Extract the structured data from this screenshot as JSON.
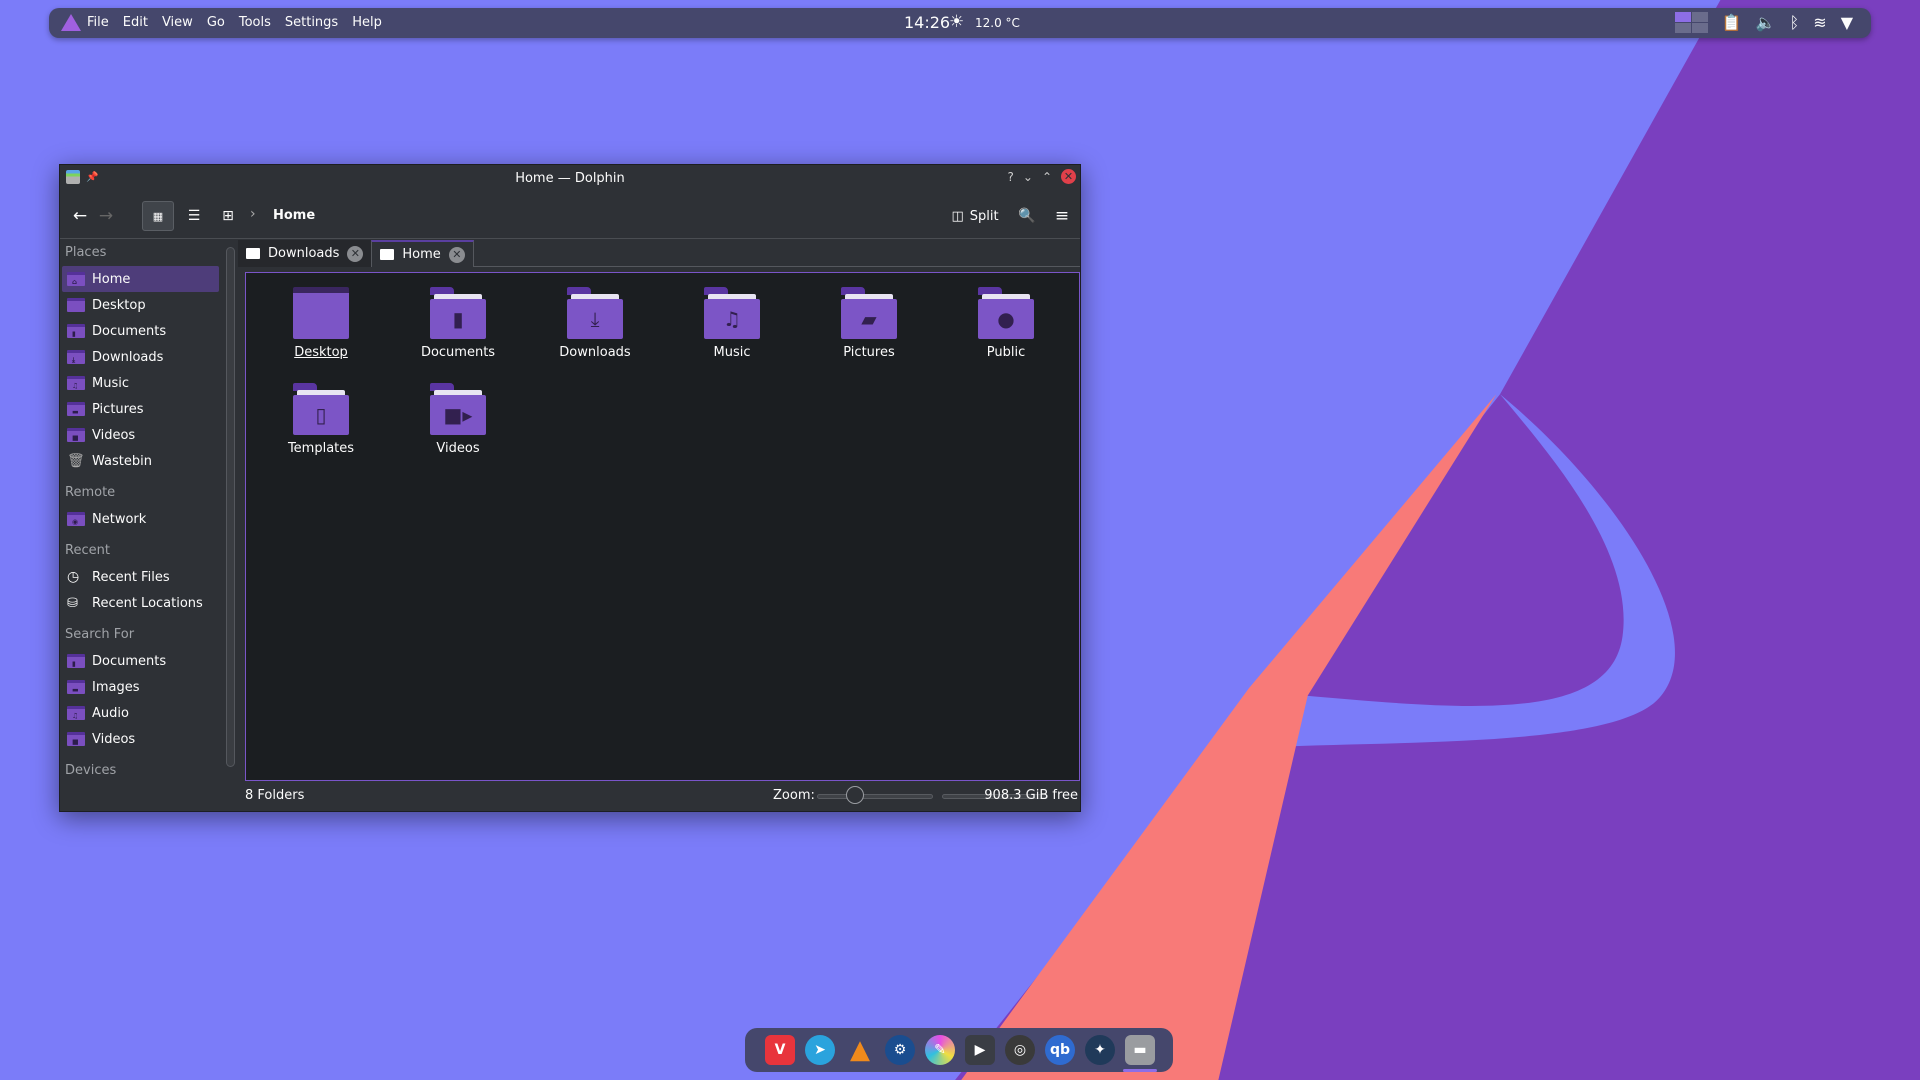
{
  "colors": {
    "wallpaper": "#7b7cf9",
    "accent": "#7c55c6",
    "coral": "#f87a78",
    "dark_purple": "#7a3fbf"
  },
  "topbar": {
    "logo": "app-launcher-icon",
    "menus": [
      "File",
      "Edit",
      "View",
      "Go",
      "Tools",
      "Settings",
      "Help"
    ],
    "clock": "14:26",
    "weather_icon": "sun-icon",
    "temperature": "12.0 °C",
    "tray": [
      "virtual-desktop-pager",
      "clipboard-icon",
      "volume-icon",
      "bluetooth-icon",
      "wifi-icon",
      "expand-tray-icon"
    ]
  },
  "window": {
    "title": "Home — Dolphin",
    "controls": {
      "help": "?",
      "minimize": "⌄",
      "maximize": "⌃",
      "close": "✕"
    },
    "toolbar": {
      "back": "←",
      "forward": "→",
      "breadcrumb": "Home",
      "split": "Split"
    },
    "sidebar": [
      {
        "section": "Places",
        "items": [
          {
            "label": "Home",
            "glyph": "⌂",
            "active": true
          },
          {
            "label": "Desktop",
            "glyph": ""
          },
          {
            "label": "Documents",
            "glyph": "▮"
          },
          {
            "label": "Downloads",
            "glyph": "⤓"
          },
          {
            "label": "Music",
            "glyph": "♫"
          },
          {
            "label": "Pictures",
            "glyph": "▬"
          },
          {
            "label": "Videos",
            "glyph": "■"
          },
          {
            "label": "Wastebin",
            "icon": "trash"
          }
        ]
      },
      {
        "section": "Remote",
        "items": [
          {
            "label": "Network",
            "glyph": "◉"
          }
        ]
      },
      {
        "section": "Recent",
        "items": [
          {
            "label": "Recent Files",
            "icon": "clock"
          },
          {
            "label": "Recent Locations",
            "icon": "location"
          }
        ]
      },
      {
        "section": "Search For",
        "items": [
          {
            "label": "Documents",
            "glyph": "▮"
          },
          {
            "label": "Images",
            "glyph": "▬"
          },
          {
            "label": "Audio",
            "glyph": "♫"
          },
          {
            "label": "Videos",
            "glyph": "■"
          }
        ]
      },
      {
        "section": "Devices",
        "items": []
      }
    ],
    "tabs": [
      {
        "label": "Downloads",
        "active": false
      },
      {
        "label": "Home",
        "active": true
      }
    ],
    "folders": [
      {
        "name": "Desktop",
        "glyph": ""
      },
      {
        "name": "Documents",
        "glyph": "▮"
      },
      {
        "name": "Downloads",
        "glyph": "⤓"
      },
      {
        "name": "Music",
        "glyph": "♫"
      },
      {
        "name": "Pictures",
        "glyph": "▰"
      },
      {
        "name": "Public",
        "glyph": "●"
      },
      {
        "name": "Templates",
        "glyph": "▯"
      },
      {
        "name": "Videos",
        "glyph": "■▸"
      }
    ],
    "status": {
      "count": "8 Folders",
      "zoom_label": "Zoom:",
      "zoom_level": 0.3,
      "free": "908.3 GiB free",
      "disk_used": 0.0
    }
  },
  "dock": [
    {
      "name": "vivaldi",
      "glyph": "V",
      "bg": "#e8343c",
      "shape": "square"
    },
    {
      "name": "telegram",
      "glyph": "➤",
      "bg": "#2aa3dd",
      "shape": "circle"
    },
    {
      "name": "vlc",
      "glyph": "▲",
      "bg": "transparent",
      "shape": "cone"
    },
    {
      "name": "steam",
      "glyph": "⚙",
      "bg": "#1a4d8f",
      "shape": "circle"
    },
    {
      "name": "krita",
      "glyph": "✎",
      "bg": "conic-gradient(#e64ce6,#f0e040,#30c0e0,#e64ce6)",
      "shape": "circle"
    },
    {
      "name": "kdenlive",
      "glyph": "▶",
      "bg": "#3a3d44",
      "shape": "square"
    },
    {
      "name": "obs",
      "glyph": "◎",
      "bg": "#3a3a3a",
      "shape": "circle"
    },
    {
      "name": "qbittorrent",
      "glyph": "qb",
      "bg": "#2f6bd0",
      "shape": "circle"
    },
    {
      "name": "mullvad",
      "glyph": "✦",
      "bg": "#203a5a",
      "shape": "circle"
    },
    {
      "name": "dolphin",
      "glyph": "▬",
      "bg": "#9a9ca0",
      "shape": "square",
      "active": true
    }
  ]
}
